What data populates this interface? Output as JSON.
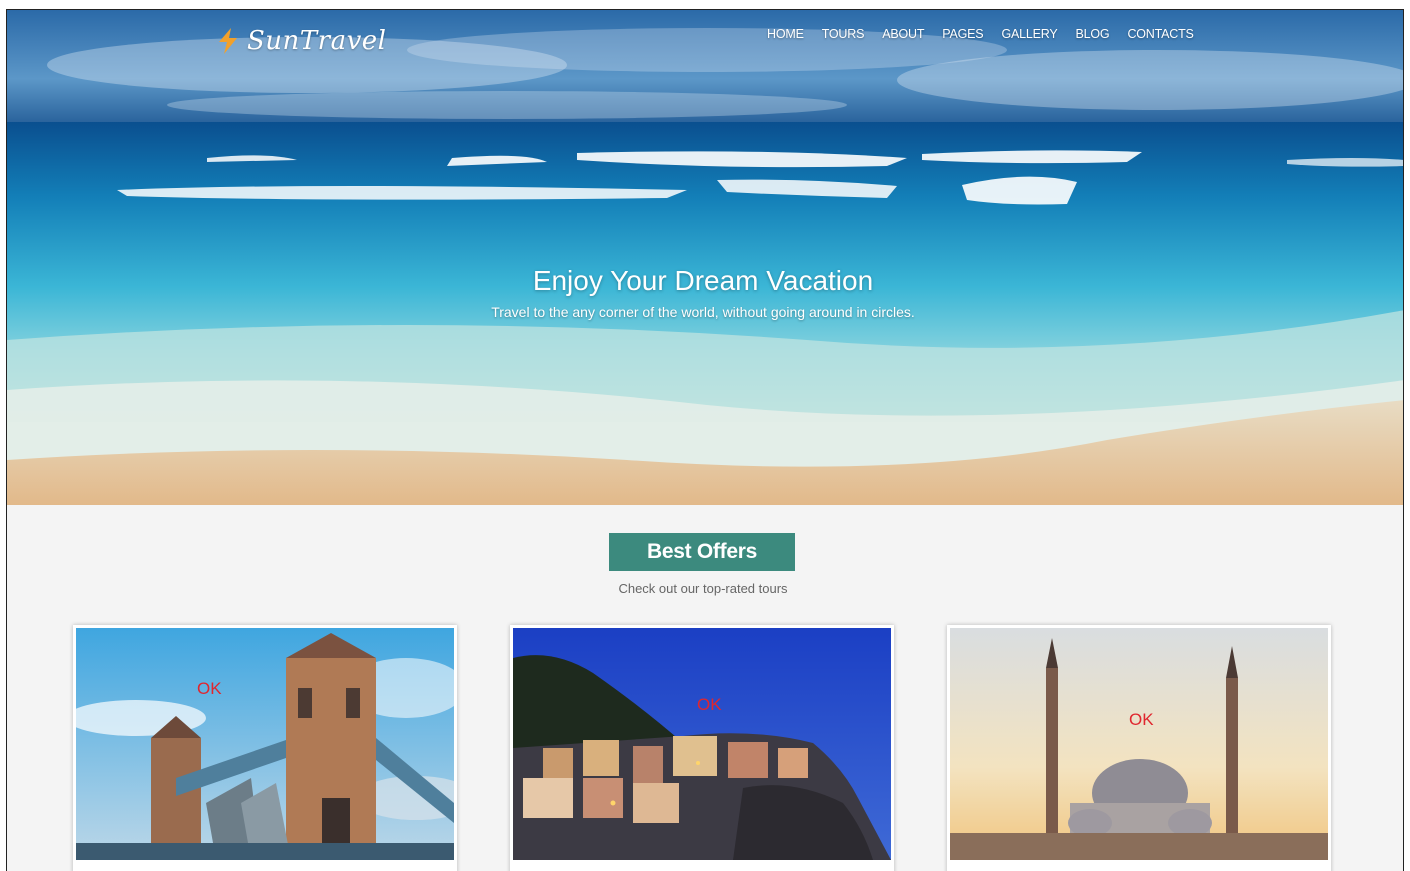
{
  "brand": {
    "name": "SunTravel"
  },
  "nav": {
    "items": [
      "HOME",
      "TOURS",
      "ABOUT",
      "PAGES",
      "GALLERY",
      "BLOG",
      "CONTACTS"
    ]
  },
  "hero": {
    "title": "Enjoy Your Dream Vacation",
    "subtitle": "Travel to the any corner of the world, without going around in circles."
  },
  "offers": {
    "button_label": "Best Offers",
    "subtitle": "Check out our top-rated tours",
    "cards": [
      {
        "label": "OK",
        "image": "tower-bridge-photo"
      },
      {
        "label": "OK",
        "image": "coastal-village-night-photo"
      },
      {
        "label": "OK",
        "image": "mosque-sunset-photo"
      }
    ]
  },
  "colors": {
    "accent": "#3c8a7e",
    "ok_label": "#e0262e",
    "logo_icon": "#f2a12b"
  }
}
